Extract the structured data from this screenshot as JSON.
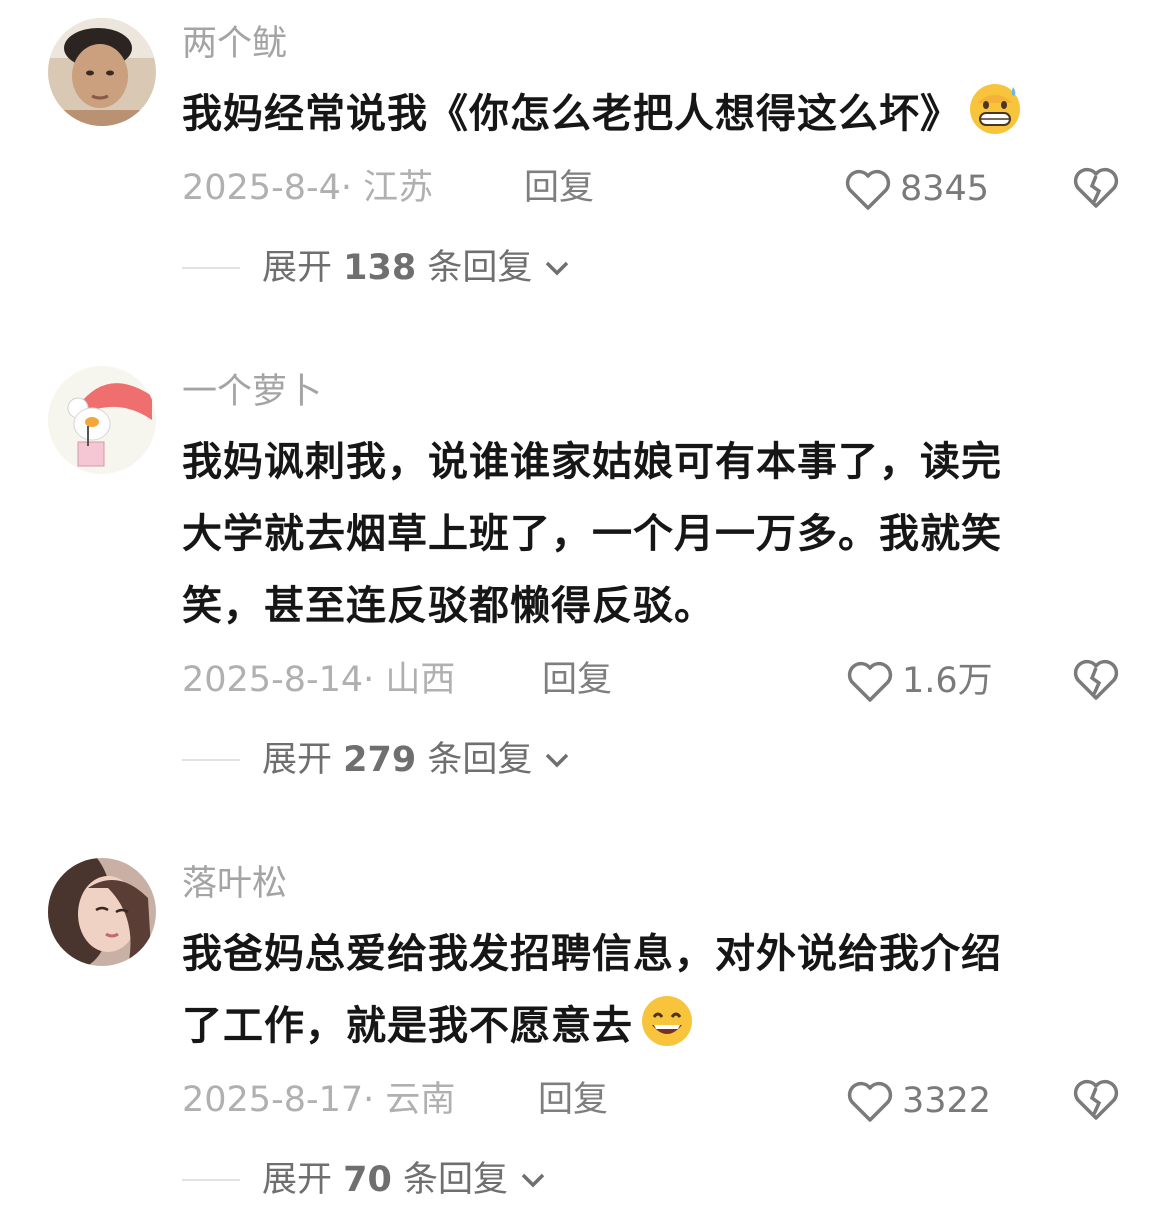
{
  "comments": [
    {
      "username": "两个鱿",
      "text": "我妈经常说我《你怎么老把人想得这么坏》",
      "emoji": "grinning-sweat-emoji",
      "date": "2025-8-4",
      "region": "· 江苏",
      "reply_label": "回复",
      "likes": "8345",
      "expand_prefix": "展开",
      "expand_count": "138",
      "expand_suffix": "条回复"
    },
    {
      "username": "一个萝卜",
      "text_lines": [
        "我妈讽刺我，说谁谁家姑娘可有本事了，读完",
        "大学就去烟草上班了，一个月一万多。我就笑",
        "笑，甚至连反驳都懒得反驳。"
      ],
      "date": "2025-8-14",
      "region": "· 山西",
      "reply_label": "回复",
      "likes": "1.6万",
      "expand_prefix": "展开",
      "expand_count": "279",
      "expand_suffix": "条回复"
    },
    {
      "username": "落叶松",
      "text_lines": [
        "我爸妈总爱给我发招聘信息，对外说给我介绍",
        "了工作，就是我不愿意去"
      ],
      "emoji": "grinning-emoji",
      "date": "2025-8-17",
      "region": "· 云南",
      "reply_label": "回复",
      "likes": "3322",
      "expand_prefix": "展开",
      "expand_count": "70",
      "expand_suffix": "条回复"
    }
  ],
  "colors": {
    "username": "#a4a4a4",
    "body": "#161616",
    "meta": "#b0b0b0",
    "action": "#7a7a7a"
  }
}
